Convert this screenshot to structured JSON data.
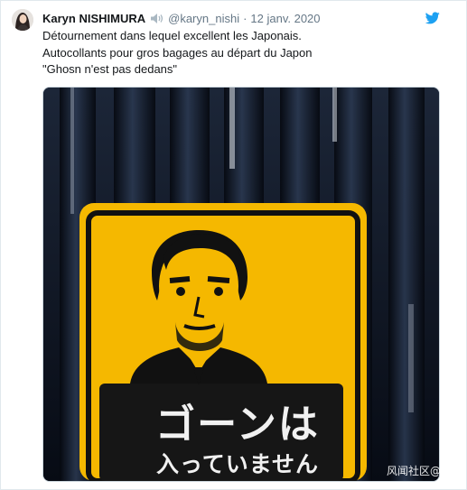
{
  "tweet": {
    "author_name": "Karyn NISHIMURA",
    "handle": "@karyn_nishi",
    "separator": "·",
    "date": "12 janv. 2020",
    "lines": [
      "Détournement dans lequel excellent les Japonais.",
      "Autocollants pour gros bagages au départ du Japon",
      "\"Ghosn n'est pas dedans\""
    ]
  },
  "image": {
    "sticker_text_main": "ゴーンは",
    "sticker_text_sub": "入っていません",
    "sticker_color": "#f5b800",
    "background_color": "#0d1626"
  },
  "watermark": "风闻社区@德不",
  "icons": {
    "avatar": "avatar-image",
    "speaker": "speaker-volume-icon",
    "twitter": "twitter-bird-icon"
  },
  "colors": {
    "text": "#14171a",
    "muted": "#657786",
    "twitter_blue": "#1da1f2"
  }
}
